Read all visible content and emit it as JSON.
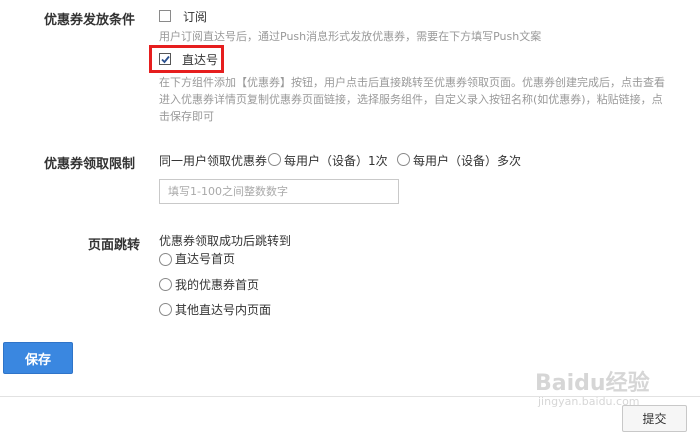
{
  "coupon_conditions": {
    "label": "优惠券发放条件",
    "subscribe": {
      "label": "订阅",
      "checked": false,
      "hint": "用户订阅直达号后，通过Push消息形式发放优惠券，需要在下方填写Push文案"
    },
    "direct": {
      "label": "直达号",
      "checked": true,
      "hint": "在下方组件添加【优惠券】按钮，用户点击后直接跳转至优惠券领取页面。优惠券创建完成后，点击查看进入优惠券详情页复制优惠券页面链接，选择服务组件，自定义录入按钮名称(如优惠券)，粘贴链接，点击保存即可"
    }
  },
  "coupon_limit": {
    "label": "优惠券领取限制",
    "prefix": "同一用户领取优惠券",
    "options": [
      "每用户（设备）1次",
      "每用户（设备）多次"
    ],
    "input_placeholder": "填写1-100之间整数数字"
  },
  "page_redirect": {
    "label": "页面跳转",
    "description": "优惠券领取成功后跳转到",
    "options": [
      "直达号首页",
      "我的优惠券首页",
      "其他直达号内页面"
    ]
  },
  "actions": {
    "save": "保存",
    "submit": "提交"
  },
  "watermark": {
    "brand": "Baidu经验",
    "url": "jingyan.baidu.com"
  },
  "colors": {
    "primary": "#3a87e0",
    "highlight": "#e61e1e"
  }
}
